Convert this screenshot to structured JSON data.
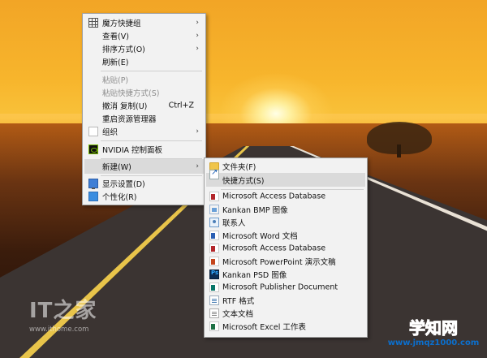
{
  "main_menu": {
    "items": [
      {
        "label": "魔方快捷组",
        "icon": "grid-icon",
        "submenu": true
      },
      {
        "label": "查看(V)",
        "submenu": true
      },
      {
        "label": "排序方式(O)",
        "submenu": true
      },
      {
        "label": "刷新(E)"
      },
      {
        "label": "粘贴(P)",
        "disabled": true
      },
      {
        "label": "粘贴快捷方式(S)",
        "disabled": true
      },
      {
        "label": "撤消 复制(U)",
        "shortcut": "Ctrl+Z"
      },
      {
        "label": "重启资源管理器"
      },
      {
        "label": "组织",
        "icon": "organize-icon",
        "submenu": true
      },
      {
        "label": "NVIDIA 控制面板",
        "icon": "nvidia-icon"
      },
      {
        "label": "新建(W)",
        "submenu": true,
        "highlighted": true
      },
      {
        "label": "显示设置(D)",
        "icon": "display-icon"
      },
      {
        "label": "个性化(R)",
        "icon": "personalize-icon"
      }
    ]
  },
  "sub_menu": {
    "items": [
      {
        "label": "文件夹(F)",
        "icon": "folder-icon"
      },
      {
        "label": "快捷方式(S)",
        "icon": "shortcut-icon",
        "highlighted": true
      },
      {
        "label": "Microsoft Access Database",
        "icon": "access-icon"
      },
      {
        "label": "Kankan BMP 图像",
        "icon": "bmp-icon"
      },
      {
        "label": "联系人",
        "icon": "contact-icon"
      },
      {
        "label": "Microsoft Word 文档",
        "icon": "word-icon"
      },
      {
        "label": "Microsoft Access Database",
        "icon": "access-icon"
      },
      {
        "label": "Microsoft PowerPoint 演示文稿",
        "icon": "powerpoint-icon"
      },
      {
        "label": "Kankan PSD 图像",
        "icon": "psd-icon"
      },
      {
        "label": "Microsoft Publisher Document",
        "icon": "publisher-icon"
      },
      {
        "label": "RTF 格式",
        "icon": "rtf-icon"
      },
      {
        "label": "文本文档",
        "icon": "text-document-icon"
      },
      {
        "label": "Microsoft Excel 工作表",
        "icon": "excel-icon"
      }
    ]
  },
  "watermarks": {
    "ithome_logo": "IT之家",
    "ithome_url": "www.ithome.com",
    "site_name": "学知网",
    "site_url": "www.jmqz1000.com"
  },
  "colors": {
    "menu_bg": "#f2f2f2",
    "menu_highlight": "#dadada",
    "disabled_text": "#8e8e8e",
    "site_blue": "#0b6fce"
  }
}
